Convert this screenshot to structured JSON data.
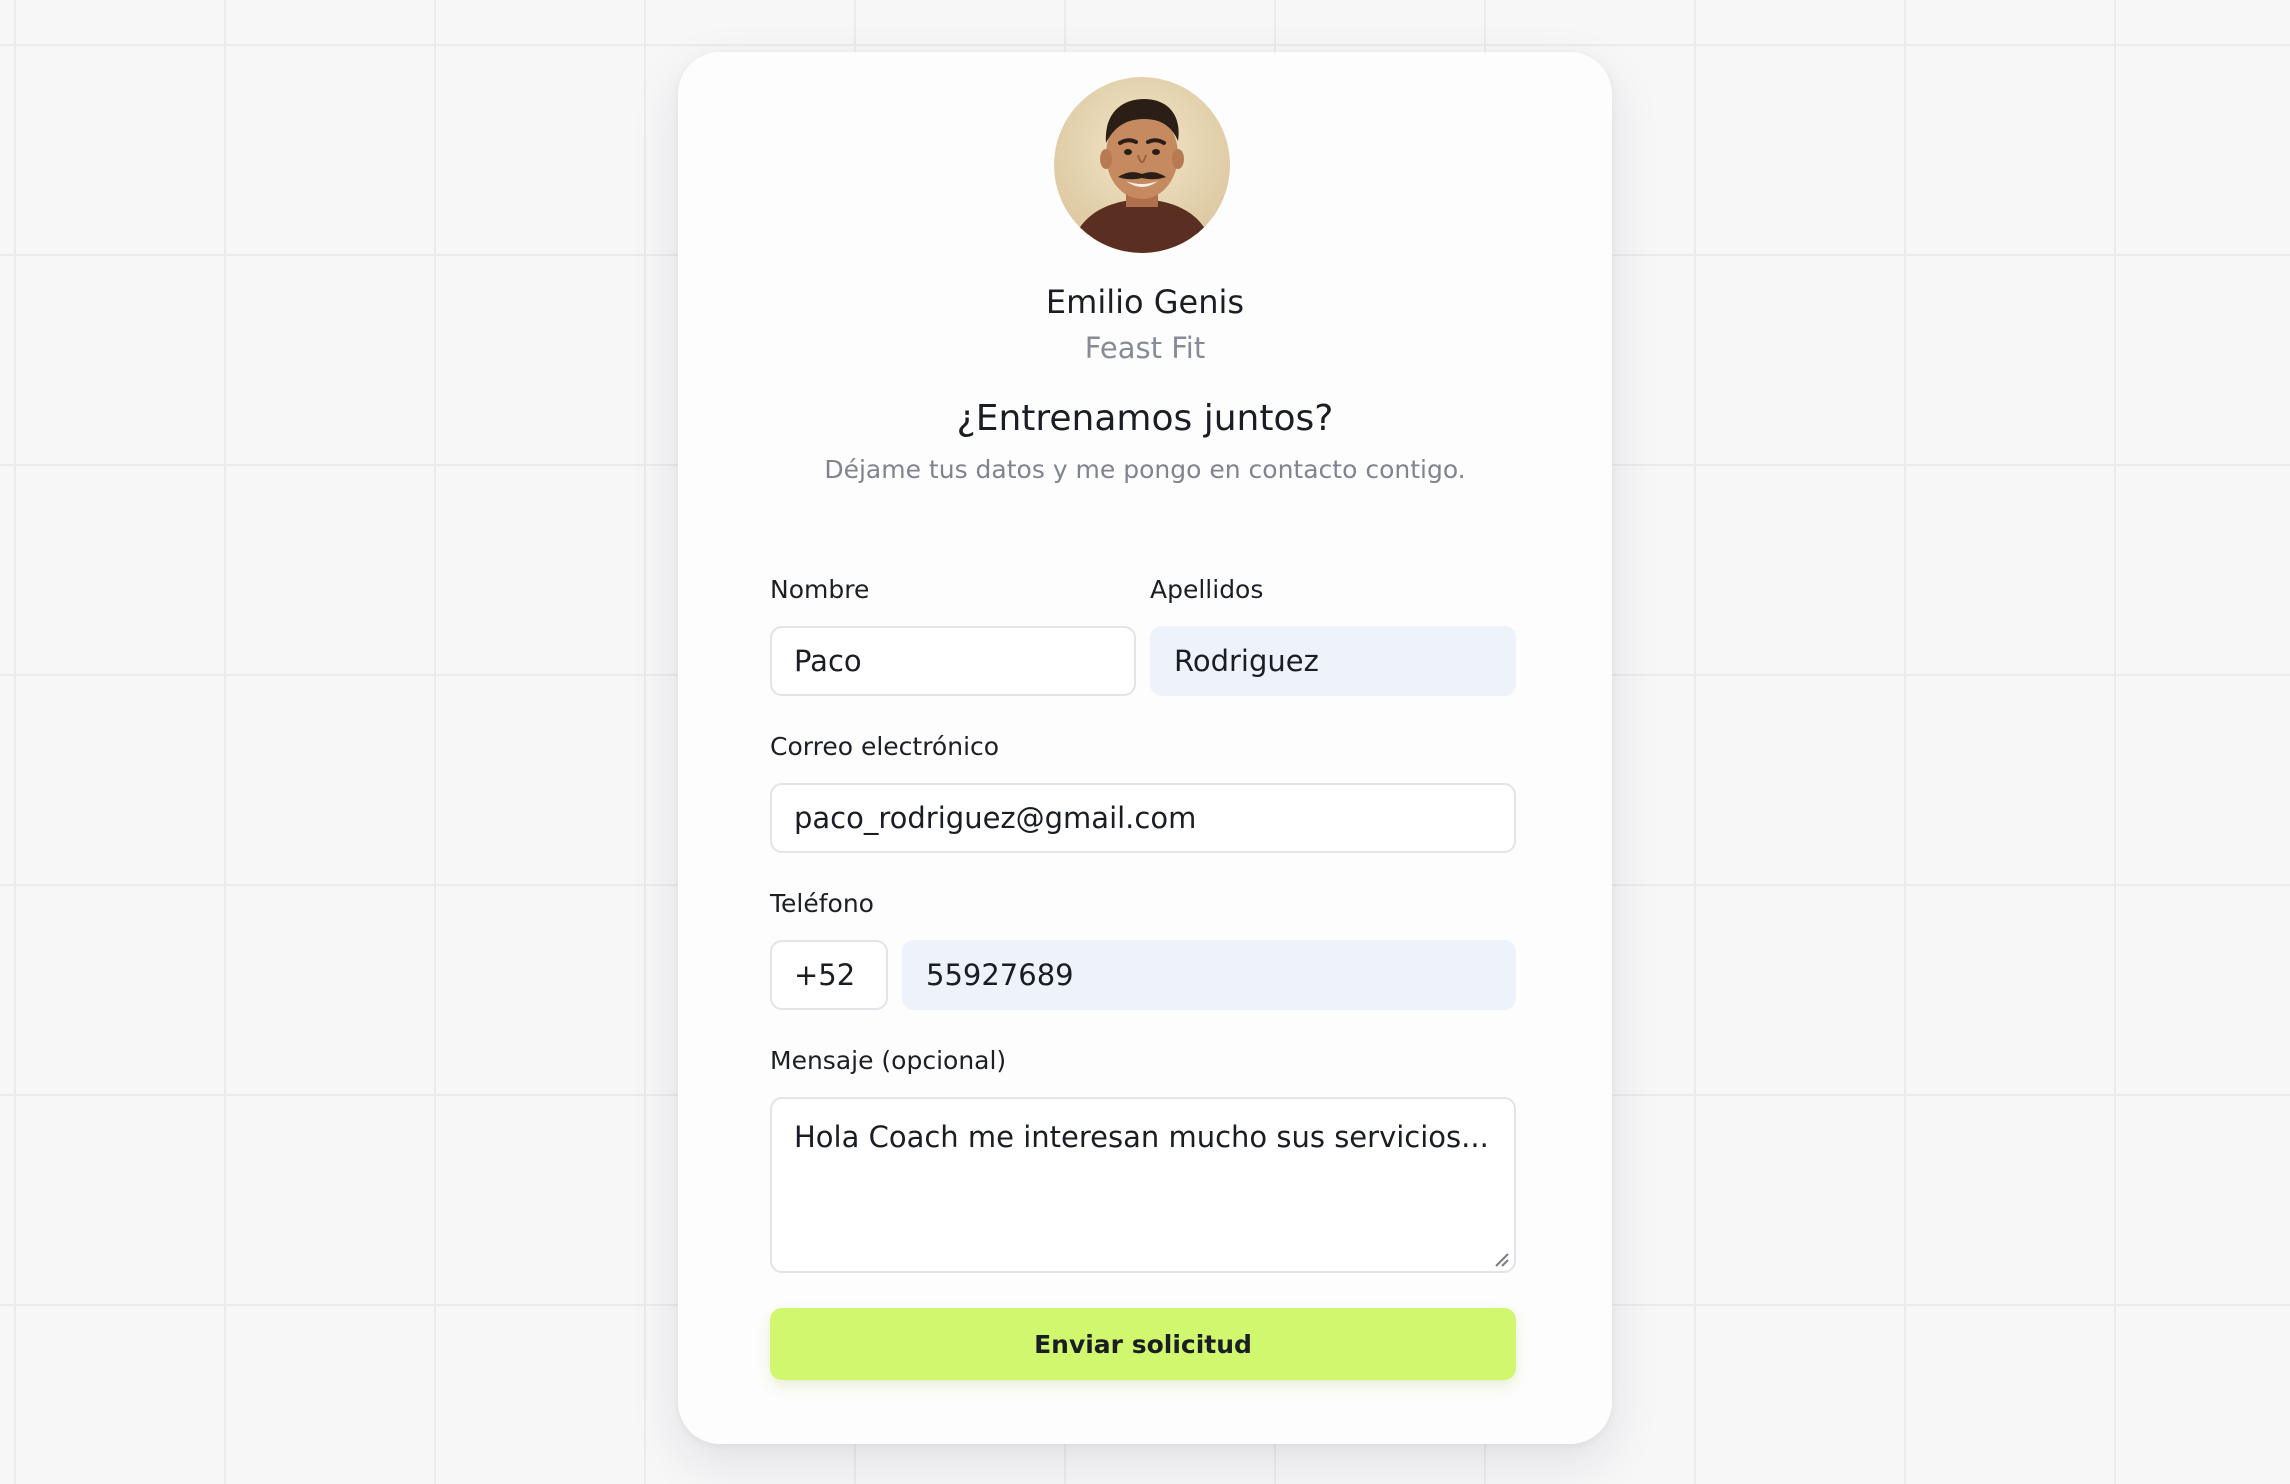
{
  "coach": {
    "name": "Emilio Genis",
    "brand": "Feast Fit"
  },
  "intro": {
    "heading": "¿Entrenamos juntos?",
    "subheading": "Déjame tus datos y me pongo en contacto contigo."
  },
  "form": {
    "first_name": {
      "label": "Nombre",
      "value": "Paco"
    },
    "last_name": {
      "label": "Apellidos",
      "value": "Rodriguez"
    },
    "email": {
      "label": "Correo electrónico",
      "value": "paco_rodriguez@gmail.com"
    },
    "phone": {
      "label": "Teléfono",
      "country_code": "+52",
      "number": "55927689"
    },
    "message": {
      "label": "Mensaje (opcional)",
      "value": "Hola Coach me interesan mucho sus servicios..."
    },
    "submit_label": "Enviar solicitud"
  },
  "colors": {
    "accent": "#d0f76d",
    "autofill_background": "#edf2fb"
  },
  "icons": {
    "avatar": "coach-portrait",
    "textarea_grip": "resize-grip-icon"
  }
}
